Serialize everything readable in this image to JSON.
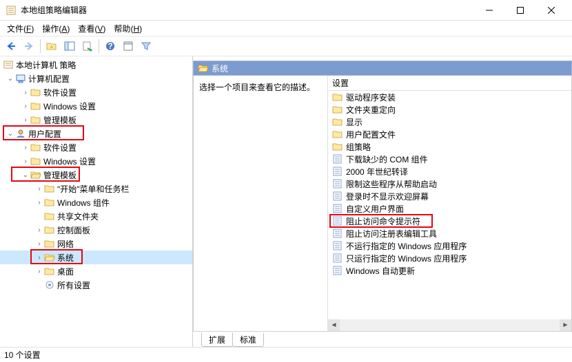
{
  "titlebar": {
    "title": "本地组策略编辑器"
  },
  "menubar": {
    "file": "文件",
    "file_u": "F",
    "action": "操作",
    "action_u": "A",
    "view": "查看",
    "view_u": "V",
    "help": "帮助",
    "help_u": "H"
  },
  "tree": {
    "root": "本地计算机 策略",
    "computer_cfg": "计算机配置",
    "user_cfg": "用户配置",
    "software_settings": "软件设置",
    "windows_settings": "Windows 设置",
    "admin_templates": "管理模板",
    "start_taskbar": "\"开始\"菜单和任务栏",
    "windows_components": "Windows 组件",
    "shared_folders": "共享文件夹",
    "control_panel": "控制面板",
    "network": "网络",
    "system": "系统",
    "desktop": "桌面",
    "all_settings": "所有设置"
  },
  "right": {
    "header_title": "系统",
    "desc_prompt": "选择一个项目来查看它的描述。",
    "column_setting": "设置",
    "items": [
      {
        "type": "folder",
        "label": "驱动程序安装"
      },
      {
        "type": "folder",
        "label": "文件夹重定向"
      },
      {
        "type": "folder",
        "label": "显示"
      },
      {
        "type": "folder",
        "label": "用户配置文件"
      },
      {
        "type": "folder",
        "label": "组策略"
      },
      {
        "type": "setting",
        "label": "下载缺少的 COM 组件"
      },
      {
        "type": "setting",
        "label": "2000 年世纪转译"
      },
      {
        "type": "setting",
        "label": "限制这些程序从帮助启动"
      },
      {
        "type": "setting",
        "label": "登录时不显示欢迎屏幕"
      },
      {
        "type": "setting",
        "label": "自定义用户界面"
      },
      {
        "type": "setting",
        "label": "阻止访问命令提示符",
        "highlight": true
      },
      {
        "type": "setting",
        "label": "阻止访问注册表编辑工具"
      },
      {
        "type": "setting",
        "label": "不运行指定的 Windows 应用程序"
      },
      {
        "type": "setting",
        "label": "只运行指定的 Windows 应用程序"
      },
      {
        "type": "setting",
        "label": "Windows 自动更新"
      }
    ],
    "tab_ext": "扩展",
    "tab_std": "标准"
  },
  "statusbar": {
    "text": "10 个设置"
  }
}
